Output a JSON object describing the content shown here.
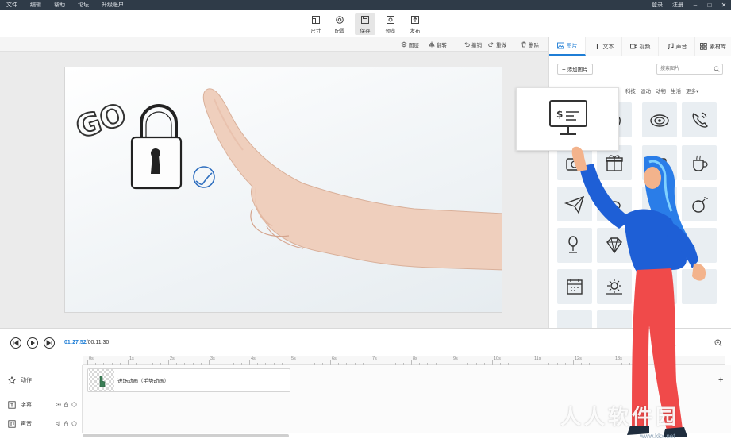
{
  "menubar": {
    "items": [
      "文件",
      "编辑",
      "帮助",
      "论坛",
      "升级账户"
    ],
    "login": "登录",
    "register": "注册"
  },
  "toolbar": {
    "size": "尺寸",
    "config": "配置",
    "save": "保存",
    "preview": "预览",
    "publish": "发布"
  },
  "subtoolbar": {
    "layer": "图层",
    "flip": "翻转",
    "undo": "撤销",
    "redo": "重做",
    "delete": "删除"
  },
  "panel": {
    "tabs": [
      "图片",
      "文本",
      "视频",
      "声音",
      "素材库"
    ],
    "add_image": "添加图片",
    "search_placeholder": "搜索图片",
    "categories": [
      "科技",
      "运动",
      "动物",
      "生活",
      "更多▾"
    ]
  },
  "canvas": {
    "go_text": "GO"
  },
  "timeline": {
    "time_current": "01:27.52",
    "time_separator": "/",
    "time_total": "00:11.30",
    "ruler_labels": [
      "0s",
      "1s",
      "2s",
      "3s",
      "4s",
      "5s",
      "6s",
      "7s",
      "8s",
      "9s",
      "10s",
      "11s",
      "12s",
      "13s"
    ],
    "tracks": [
      {
        "name": "动作"
      },
      {
        "name": "字幕"
      },
      {
        "name": "声音"
      }
    ],
    "clip_label": "进场动画（手势动画）"
  },
  "watermark": {
    "text": "人人软件园",
    "url": "www.kkx.net"
  },
  "colors": {
    "accent": "#1f7ed6",
    "menubar_bg": "#2f3b48",
    "character_blue": "#1e5fd6",
    "character_red": "#f04a4a"
  }
}
